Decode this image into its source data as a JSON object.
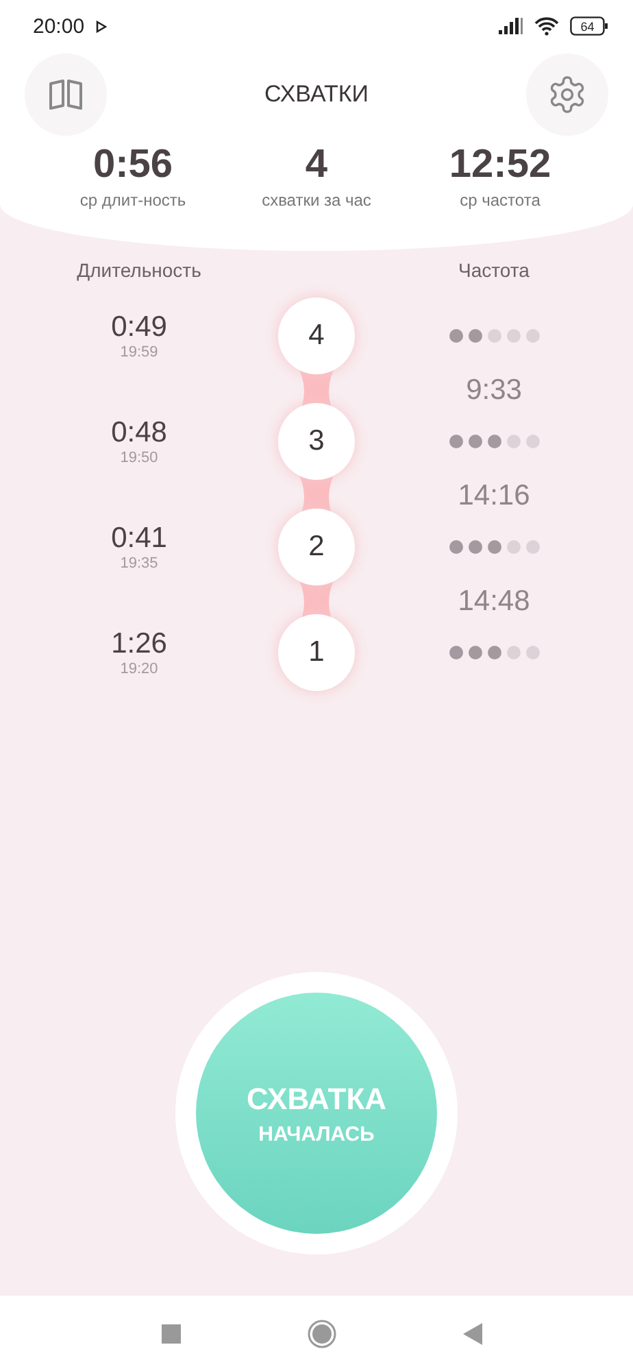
{
  "status_bar": {
    "time": "20:00",
    "battery": "64"
  },
  "header": {
    "title": "СХВАТКИ"
  },
  "stats": [
    {
      "value": "0:56",
      "label": "ср длит-ность"
    },
    {
      "value": "4",
      "label": "схватки за час"
    },
    {
      "value": "12:52",
      "label": "ср частота"
    }
  ],
  "columns": {
    "duration": "Длительность",
    "frequency": "Частота"
  },
  "contractions": [
    {
      "duration": "0:49",
      "time": "19:59",
      "number": "4",
      "stars": 2,
      "frequency": "9:33"
    },
    {
      "duration": "0:48",
      "time": "19:50",
      "number": "3",
      "stars": 3,
      "frequency": "14:16"
    },
    {
      "duration": "0:41",
      "time": "19:35",
      "number": "2",
      "stars": 3,
      "frequency": "14:48"
    },
    {
      "duration": "1:26",
      "time": "19:20",
      "number": "1",
      "stars": 3
    }
  ],
  "start_button": {
    "line_1": "СХВАТКА",
    "line_2": "НАЧАЛАСЬ"
  }
}
